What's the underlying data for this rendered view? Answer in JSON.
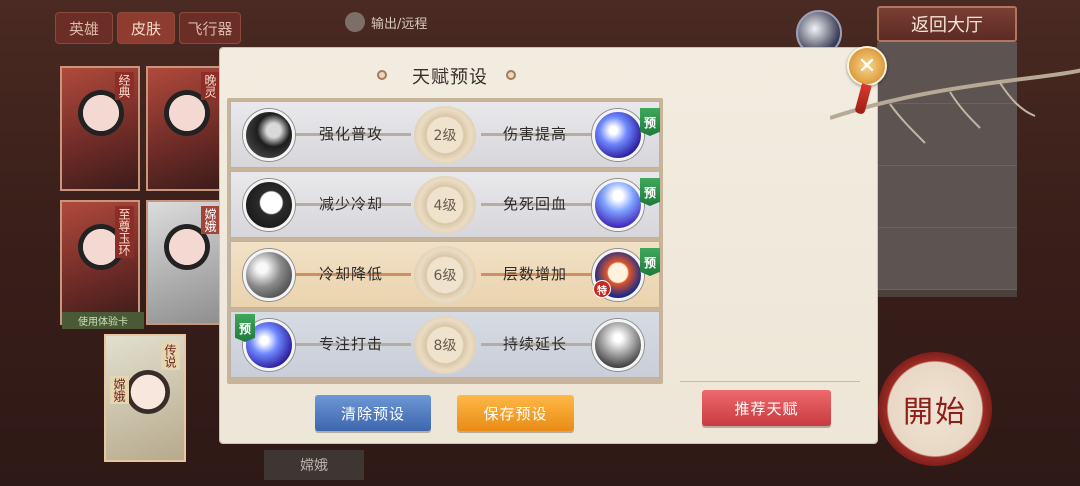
{
  "background": {
    "tabs": [
      "英雄",
      "皮肤",
      "飞行器"
    ],
    "active_tab": "皮肤",
    "route_text": "输出/远程",
    "return_button": "返回大厅",
    "cards": [
      {
        "label": "经典"
      },
      {
        "label": "晚灵"
      },
      {
        "label": "至尊玉环"
      },
      {
        "label": "嫦娥"
      }
    ],
    "use_note": "使用体验卡",
    "big_card_label": "传说",
    "big_card_label2": "嫦娥",
    "name_tab": "嫦娥",
    "start_button": "開始"
  },
  "modal": {
    "title": "天赋预设",
    "close_icon": "close-icon",
    "rows": [
      {
        "left": "强化普攻",
        "level": "2级",
        "right": "伤害提高",
        "left_icon": "dark-swirl-icon",
        "right_icon": "blue-slash-icon",
        "badge_right": "预"
      },
      {
        "left": "减少冷却",
        "level": "4级",
        "right": "免死回血",
        "left_icon": "moon-figure-icon",
        "right_icon": "blue-rays-icon",
        "badge_right": "预"
      },
      {
        "left": "冷却降低",
        "level": "6级",
        "right": "层数增加",
        "left_icon": "gray-rays-icon",
        "right_icon": "special-orb-icon",
        "badge_right": "预",
        "special_badge": "特"
      },
      {
        "left": "专注打击",
        "level": "8级",
        "right": "持续延长",
        "left_icon": "blue-burst-icon",
        "right_icon": "gray-burst-icon",
        "badge_left": "预"
      }
    ],
    "buttons": {
      "clear": "清除预设",
      "save": "保存预设",
      "recommend": "推荐天赋"
    }
  },
  "colors": {
    "clear_button": "#4f79c0",
    "save_button": "#f5a02c",
    "recommend_button": "#dc4f55",
    "preset_badge": "#2f9150"
  }
}
